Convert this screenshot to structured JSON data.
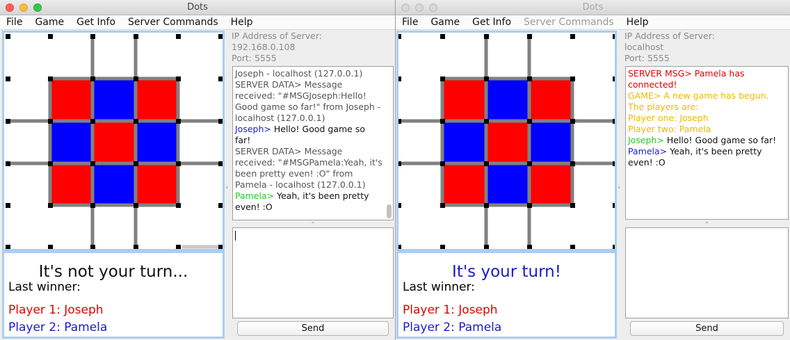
{
  "windows": [
    {
      "title": "Dots",
      "active": true,
      "menu": [
        "File",
        "Game",
        "Get Info",
        "Server Commands",
        "Help"
      ],
      "server": {
        "label": "IP Address of Server:",
        "address": "192.168.0.108",
        "port": "Port: 5555"
      },
      "chat": [
        {
          "color": "gray",
          "text": "Joseph - localhost (127.0.0.1)"
        },
        {
          "color": "gray",
          "text": "SERVER DATA> Message received: \"#MSGJoseph:Hello! Good game so far!\" from Joseph - localhost (127.0.0.1)"
        },
        {
          "color": "blue",
          "prefix": "Joseph>",
          "text": " Hello! Good game so far!"
        },
        {
          "color": "gray",
          "text": "SERVER DATA> Message received: \"#MSGPamela:Yeah, it's been pretty even! :O\" from Pamela - localhost (127.0.0.1)"
        },
        {
          "color": "green",
          "prefix": "Pamela>",
          "text": " Yeah, it's been pretty even! :O"
        }
      ],
      "status": {
        "turn": "It's not your turn...",
        "turn_color": "#111111",
        "last_winner": "Last winner:",
        "player1": "Player 1: Joseph",
        "player2": "Player 2: Pamela"
      },
      "send_label": "Send"
    },
    {
      "title": "Dots",
      "active": false,
      "menu": [
        "File",
        "Game",
        "Get Info",
        "Server Commands",
        "Help"
      ],
      "server": {
        "label": "IP Address of Server:",
        "address": "localhost",
        "port": "Port: 5555"
      },
      "chat": [
        {
          "color": "red",
          "text": "SERVER MSG> Pamela has connected!"
        },
        {
          "color": "gold",
          "text": "GAME> A new game has begun."
        },
        {
          "color": "gold",
          "text": "The players are:"
        },
        {
          "color": "gold",
          "text": "Player one: Joseph"
        },
        {
          "color": "gold",
          "text": "Player two: Pamela"
        },
        {
          "color": "green",
          "prefix": "Joseph>",
          "text": " Hello! Good game so far!"
        },
        {
          "color": "blue",
          "prefix": "Pamela>",
          "text": " Yeah, it's been pretty even! :O"
        }
      ],
      "status": {
        "turn": "It's your turn!",
        "turn_color": "#1a1ad0",
        "last_winner": "Last winner:",
        "player1": "Player 1: Joseph",
        "player2": "Player 2: Pamela"
      },
      "send_label": "Send"
    }
  ],
  "board": {
    "colors": {
      "red": "#ff0000",
      "blue": "#0000ff",
      "line": "#808080",
      "dot": "#000000"
    },
    "boxes": [
      [
        "red",
        "blue",
        "red"
      ],
      [
        "blue",
        "red",
        "blue"
      ],
      [
        "red",
        "blue",
        "red"
      ]
    ]
  }
}
